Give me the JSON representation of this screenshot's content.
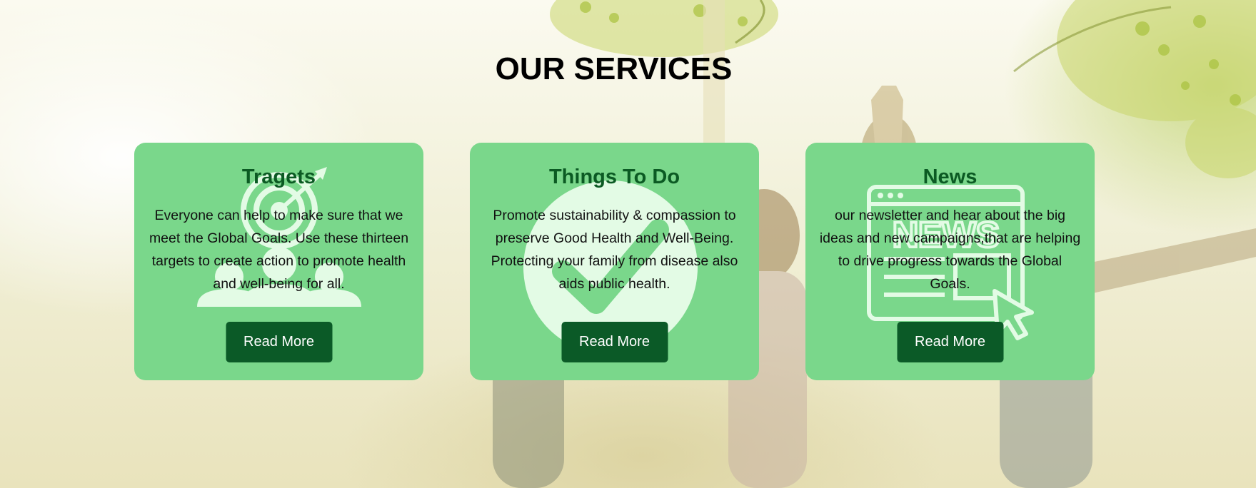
{
  "section": {
    "title": "OUR SERVICES"
  },
  "cards": [
    {
      "title": "Tragets",
      "text": "Everyone can help to make sure that we meet the Global Goals. Use these thirteen targets to create action to promote health and well-being for all.",
      "button_label": "Read More",
      "icon": "target-people-icon"
    },
    {
      "title": "Things To Do",
      "text": "Promote sustainability & compassion to preserve Good Health and Well-Being. Protecting your family from disease also aids public health.",
      "button_label": "Read More",
      "icon": "checkmark-circle-icon"
    },
    {
      "title": "News",
      "text": "our newsletter and hear about the big ideas and new campaigns,that are helping to drive progress towards the Global Goals.",
      "button_label": "Read More",
      "icon": "news-click-icon"
    }
  ],
  "colors": {
    "card_background": "#7ad78b",
    "card_title": "#0b5a23",
    "button_background": "#0b5a27",
    "button_text": "#ffffff",
    "icon_watermark": "#e3fbe5"
  }
}
